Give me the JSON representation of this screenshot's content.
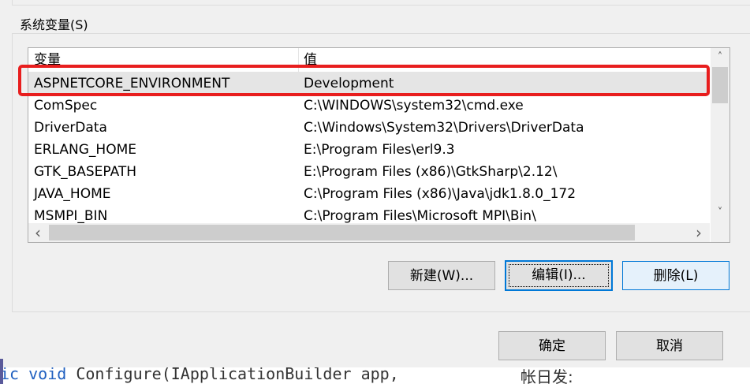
{
  "group": {
    "title": "系统变量(S)"
  },
  "table": {
    "headers": [
      "变量",
      "值"
    ],
    "rows": [
      {
        "name": "ASPNETCORE_ENVIRONMENT",
        "value": "Development"
      },
      {
        "name": "ComSpec",
        "value": "C:\\WINDOWS\\system32\\cmd.exe"
      },
      {
        "name": "DriverData",
        "value": "C:\\Windows\\System32\\Drivers\\DriverData"
      },
      {
        "name": "ERLANG_HOME",
        "value": "E:\\Program Files\\erl9.3"
      },
      {
        "name": "GTK_BASEPATH",
        "value": "E:\\Program Files (x86)\\GtkSharp\\2.12\\"
      },
      {
        "name": "JAVA_HOME",
        "value": "C:\\Program Files (x86)\\Java\\jdk1.8.0_172"
      },
      {
        "name": "MSMPI_BIN",
        "value": "C:\\Program Files\\Microsoft MPI\\Bin\\"
      }
    ]
  },
  "buttons": {
    "new": "新建(W)...",
    "edit": "编辑(I)...",
    "delete": "删除(L)",
    "ok": "确定",
    "cancel": "取消"
  },
  "scroll_glyphs": {
    "up": "˄",
    "down": "˅",
    "left": "‹",
    "right": "›"
  },
  "background_text": {
    "code_kw": "ic void",
    "code_rest": " Configure(IApplicationBuilder app,",
    "right": "帐日发:"
  },
  "colors": {
    "highlight": "#e81e1e",
    "focus": "#0078d7"
  }
}
